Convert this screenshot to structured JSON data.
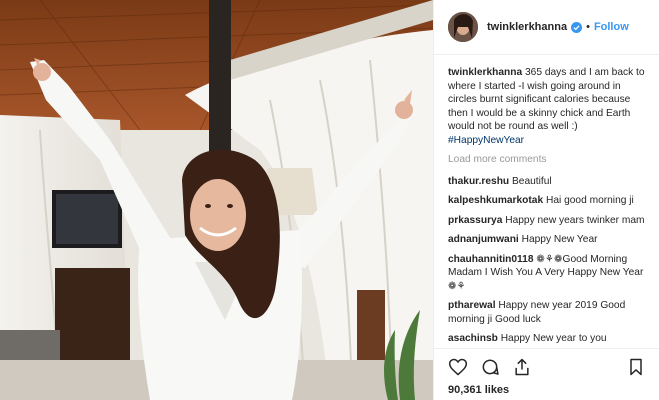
{
  "post": {
    "username": "twinklerkhanna",
    "follow_label": "Follow",
    "caption_user": "twinklerkhanna",
    "caption_text": "365 days and I am back to where I started -I wish going around in circles burnt significant calories because then I would be a skinny chick and Earth would not be round as well :)",
    "hashtag": "#HappyNewYear",
    "load_more": "Load more comments",
    "likes": "90,361 likes"
  },
  "comments": [
    {
      "user": "thakur.reshu",
      "text": "Beautiful"
    },
    {
      "user": "kalpeshkumarkotak",
      "text": "Hai good morning ji"
    },
    {
      "user": "prkassurya",
      "text": "Happy new years twinker mam"
    },
    {
      "user": "adnanjumwani",
      "text": "Happy New Year"
    },
    {
      "user": "chauhannitin0118",
      "text": "❁⚘❁Good Morning Madam I Wish You A Very Happy New Year ❁⚘"
    },
    {
      "user": "ptharewal",
      "text": "Happy new year 2019 Good morning ji Good luck"
    },
    {
      "user": "asachinsb",
      "text": "Happy New year to you"
    }
  ],
  "icons": [
    "heart-icon",
    "comment-icon",
    "share-icon",
    "bookmark-icon",
    "verified-badge-icon"
  ],
  "colors": {
    "link": "#3897f0",
    "hashtag": "#003569",
    "muted": "#999999",
    "text": "#262626"
  }
}
